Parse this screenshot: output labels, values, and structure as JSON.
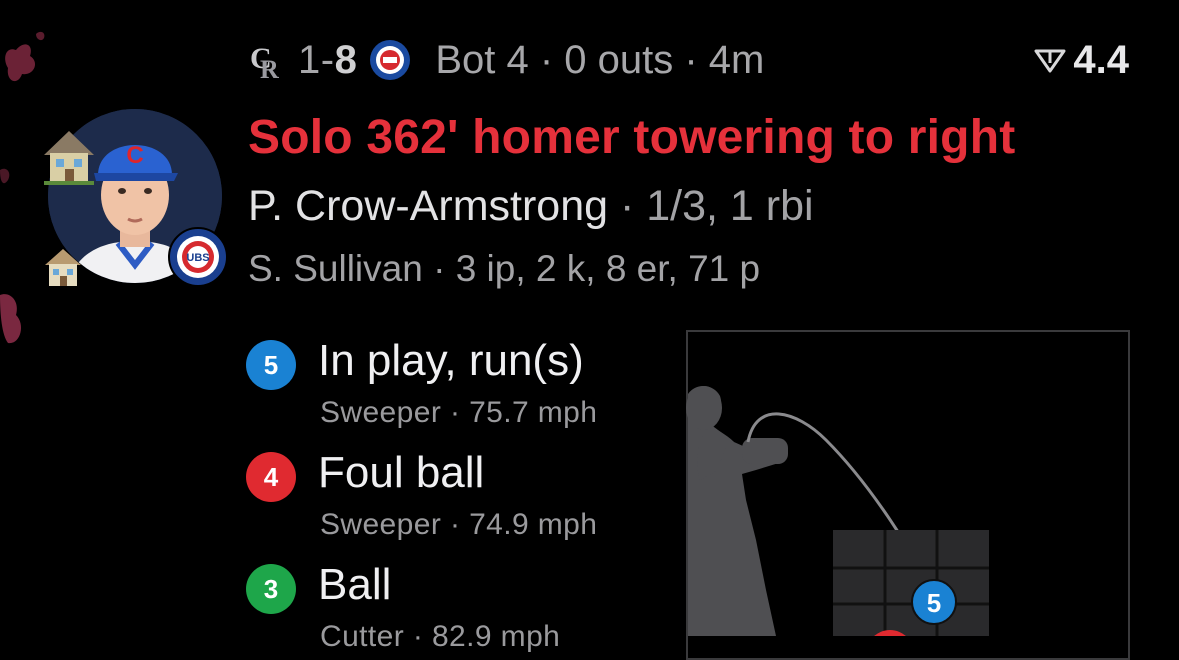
{
  "header": {
    "away_team_icon": "rockies-logo-icon",
    "away_score": "1",
    "score_separator": "-",
    "home_score": "8",
    "home_team_icon": "cubs-logo-icon",
    "game_state": "Bot 4 · 0 outs · 4m",
    "rating_icon": "rating-triangle-icon",
    "rating_value": "4.4"
  },
  "play": {
    "headline": "Solo 362' homer towering to right",
    "batter_name": "P. Crow-Armstrong",
    "batter_separator": " · ",
    "batter_stats": "1/3, 1 rbi",
    "pitcher_line": "S. Sullivan · 3 ip, 2 k, 8 er, 71 p"
  },
  "pitches": [
    {
      "number": "5",
      "result": "In play, run(s)",
      "detail": "Sweeper · 75.7 mph",
      "color": "#1a82d3"
    },
    {
      "number": "4",
      "result": "Foul ball",
      "detail": "Sweeper · 74.9 mph",
      "color": "#e02a30"
    },
    {
      "number": "3",
      "result": "Ball",
      "detail": "Cutter · 82.9 mph",
      "color": "#1ea64a"
    }
  ],
  "zone": {
    "marker_label": "5",
    "marker_color": "#1a82d3"
  },
  "colors": {
    "headline": "#e5313b",
    "background": "#000000"
  }
}
